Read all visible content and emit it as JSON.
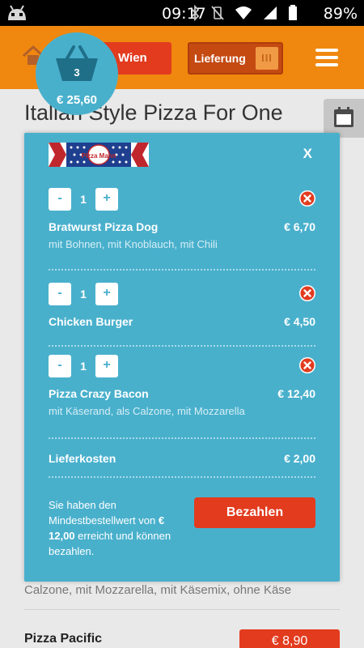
{
  "status_bar": {
    "time": "09:17",
    "battery_percent": "89%",
    "icons": [
      "android-icon",
      "bluetooth-icon",
      "vibrate-off-icon",
      "wifi-icon",
      "signal-icon",
      "battery-icon"
    ]
  },
  "app_bar": {
    "city_label": "Wien",
    "delivery_label": "Lieferung",
    "delivery_knob": "III",
    "colors": {
      "header": "#f0880f",
      "accent_red": "#e23b1e",
      "modal": "#49b0cc"
    }
  },
  "cart": {
    "count": "3",
    "total": "€ 25,60"
  },
  "page": {
    "title": "Italian Style Pizza For One",
    "bg_description": "Calzone, mit Mozzarella, mit Käsemix, ohne Käse",
    "bg_product_name": "Pizza Pacific",
    "bg_product_price": "€ 8,90"
  },
  "modal": {
    "close_label": "X",
    "logo_text": "Pizza Mann",
    "items": [
      {
        "qty": "1",
        "minus": "-",
        "plus": "+",
        "name": "Bratwurst Pizza Dog",
        "price": "€ 6,70",
        "options": "mit Bohnen, mit Knoblauch, mit Chili"
      },
      {
        "qty": "1",
        "minus": "-",
        "plus": "+",
        "name": "Chicken Burger",
        "price": "€ 4,50",
        "options": ""
      },
      {
        "qty": "1",
        "minus": "-",
        "plus": "+",
        "name": "Pizza Crazy Bacon",
        "price": "€ 12,40",
        "options": "mit Käserand, als Calzone, mit Mozzarella"
      }
    ],
    "delivery_fee_label": "Lieferkosten",
    "delivery_fee_value": "€ 2,00",
    "min_order_text_1": "Sie haben den Mindestbestellwert von",
    "min_order_amount": "€ 12,00",
    "min_order_text_2": "erreicht und können bezahlen.",
    "pay_label": "Bezahlen"
  }
}
